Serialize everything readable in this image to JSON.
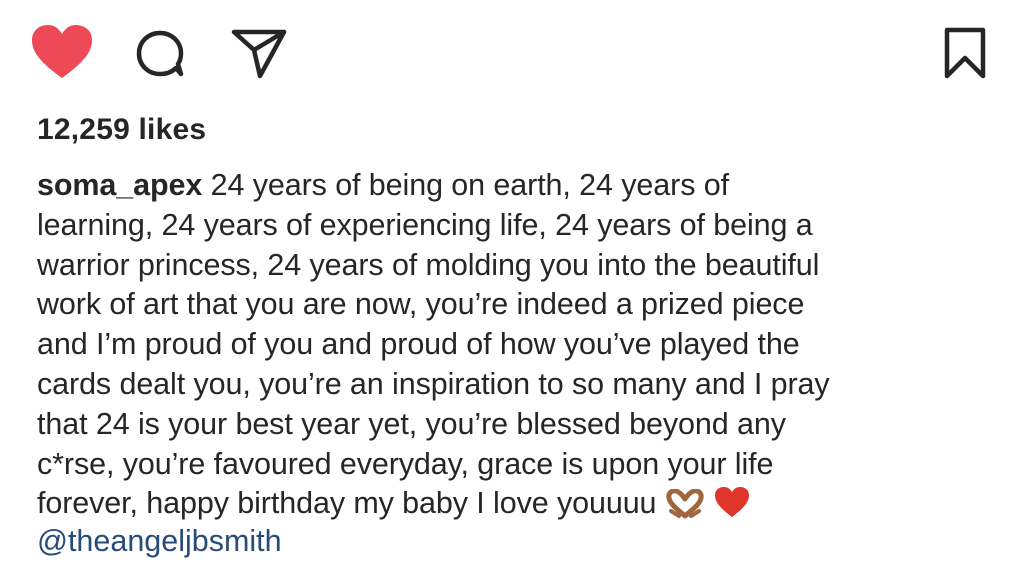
{
  "post": {
    "likes_text": "12,259 likes",
    "username": "soma_apex",
    "caption_lines": [
      "24 years of being on earth, 24 years of",
      "learning, 24 years of experiencing life, 24 years of being a",
      "warrior princess, 24 years of molding you into the beautiful",
      "work of art that you are now, you’re indeed a prized piece",
      "and I’m proud of you and proud of how you’ve played the",
      "cards dealt you, you’re an inspiration to so many and I pray",
      "that 24 is your best year yet, you’re blessed beyond any",
      "c*rse, you’re favoured everyday, grace is upon your life",
      "forever, happy birthday my baby I love youuuu"
    ],
    "caption_emojis": [
      "heart-hands-emoji",
      "red-heart-emoji"
    ],
    "mention": "@theangeljbsmith"
  },
  "actions": {
    "like_icon": "heart-icon",
    "like_color": "#ed4956",
    "comment_icon": "comment-icon",
    "share_icon": "share-icon",
    "save_icon": "bookmark-icon"
  },
  "colors": {
    "text": "#262626",
    "mention": "#284c7a"
  }
}
